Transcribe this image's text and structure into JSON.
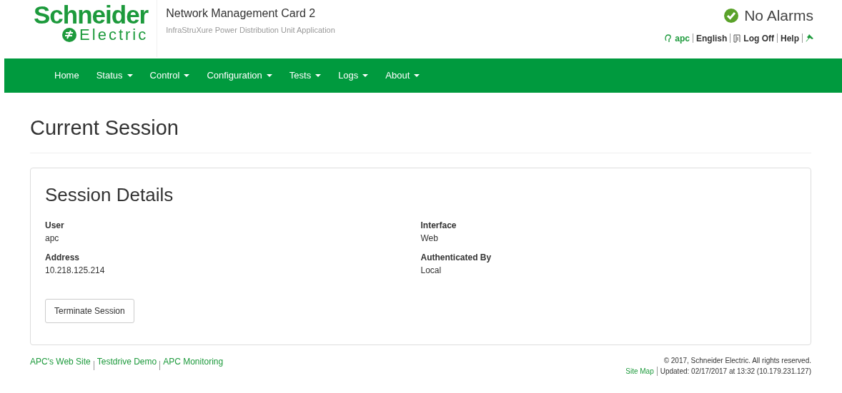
{
  "header": {
    "logo": {
      "brand": "Schneider",
      "sub": "Electric"
    },
    "title": "Network Management Card 2",
    "subtitle": "InfraStruXure Power Distribution Unit Application",
    "alarm_status": "No Alarms",
    "user_links": [
      {
        "kind": "user",
        "label": "apc"
      },
      {
        "kind": "link",
        "label": "English"
      },
      {
        "kind": "logoff",
        "label": "Log Off"
      },
      {
        "kind": "link",
        "label": "Help"
      },
      {
        "kind": "pin"
      }
    ]
  },
  "nav": [
    {
      "label": "Home",
      "dropdown": false
    },
    {
      "label": "Status",
      "dropdown": true
    },
    {
      "label": "Control",
      "dropdown": true
    },
    {
      "label": "Configuration",
      "dropdown": true
    },
    {
      "label": "Tests",
      "dropdown": true
    },
    {
      "label": "Logs",
      "dropdown": true
    },
    {
      "label": "About",
      "dropdown": true
    }
  ],
  "page_title": "Current Session",
  "session": {
    "title": "Session Details",
    "columns": [
      [
        {
          "label": "User",
          "value": "apc"
        },
        {
          "label": "Address",
          "value": "10.218.125.214"
        }
      ],
      [
        {
          "label": "Interface",
          "value": "Web"
        },
        {
          "label": "Authenticated By",
          "value": "Local"
        }
      ]
    ],
    "button": "Terminate Session"
  },
  "footer": {
    "links": [
      "APC's Web Site",
      "Testdrive Demo",
      "APC Monitoring"
    ],
    "copyright": "© 2017, Schneider Electric. All rights reserved.",
    "site_map": "Site Map",
    "updated": "Updated: 02/17/2017 at 13:32 (10.179.231.127)"
  }
}
